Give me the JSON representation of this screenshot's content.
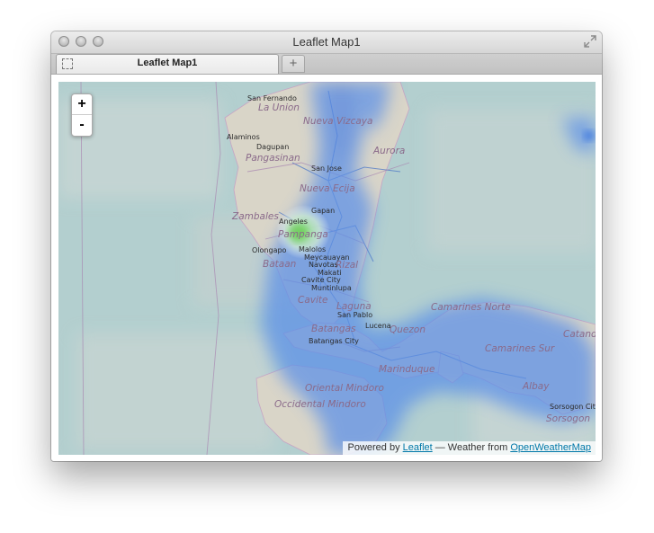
{
  "window": {
    "title": "Leaflet Map1"
  },
  "tabs": [
    {
      "label": "Leaflet Map1"
    }
  ],
  "new_tab_label": "+",
  "zoom": {
    "in_label": "+",
    "out_label": "-"
  },
  "attribution": {
    "prefix": "Powered by",
    "leaflet_link": "Leaflet",
    "separator": "— Weather from",
    "owm_link": "OpenWeatherMap"
  },
  "map": {
    "places": [
      "San Fernando",
      "Alaminos",
      "Dagupan",
      "San Jose",
      "Gapan",
      "Angeles",
      "Olongapo",
      "Malolos",
      "Meycauayan",
      "Navotas",
      "Makati",
      "Cavite City",
      "Muntinlupa",
      "San Pablo",
      "Lucena",
      "Batangas City",
      "Sorsogon City"
    ],
    "regions": [
      "La Union",
      "Nueva Vizcaya",
      "Pangasinan",
      "Aurora",
      "Nueva Ecija",
      "Zambales",
      "Pampanga",
      "Bataan",
      "Rizal",
      "Cavite",
      "Laguna",
      "Batangas",
      "Quezon",
      "Camarines Norte",
      "Camarines Sur",
      "Catand",
      "Marinduque",
      "Albay",
      "Oriental Mindoro",
      "Occidental Mindoro",
      "Sorsogon"
    ],
    "layers": {
      "base": "OpenStreetMap",
      "overlay": "precipitation"
    }
  }
}
